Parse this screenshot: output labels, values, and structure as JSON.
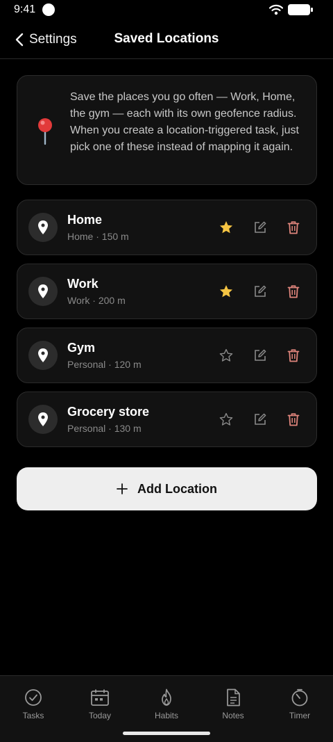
{
  "status_bar": {
    "time": "9:41"
  },
  "header": {
    "back_label": "Settings",
    "title": "Saved Locations"
  },
  "info_card": {
    "icon": "round-pushpin-emoji",
    "text": "Save the places you go often — Work, Home, the gym — each with its own geofence radius. When you create a location-triggered task, just pick one of these instead of mapping it again."
  },
  "locations": [
    {
      "name": "Home",
      "meta": "Home · 150 m",
      "starred": true
    },
    {
      "name": "Work",
      "meta": "Work · 200 m",
      "starred": true
    },
    {
      "name": "Gym",
      "meta": "Personal · 120 m",
      "starred": false
    },
    {
      "name": "Grocery store",
      "meta": "Personal · 130 m",
      "starred": false
    }
  ],
  "add_button": {
    "label": "Add Location"
  },
  "tabs": [
    {
      "label": "Tasks",
      "icon": "check-circle-icon"
    },
    {
      "label": "Today",
      "icon": "calendar-icon"
    },
    {
      "label": "Habits",
      "icon": "flame-icon"
    },
    {
      "label": "Notes",
      "icon": "document-icon"
    },
    {
      "label": "Timer",
      "icon": "timer-icon"
    }
  ],
  "colors": {
    "background": "#000000",
    "card": "#121212",
    "star_active": "#f5c443",
    "delete": "#e0857c",
    "button": "#eeeeee"
  }
}
